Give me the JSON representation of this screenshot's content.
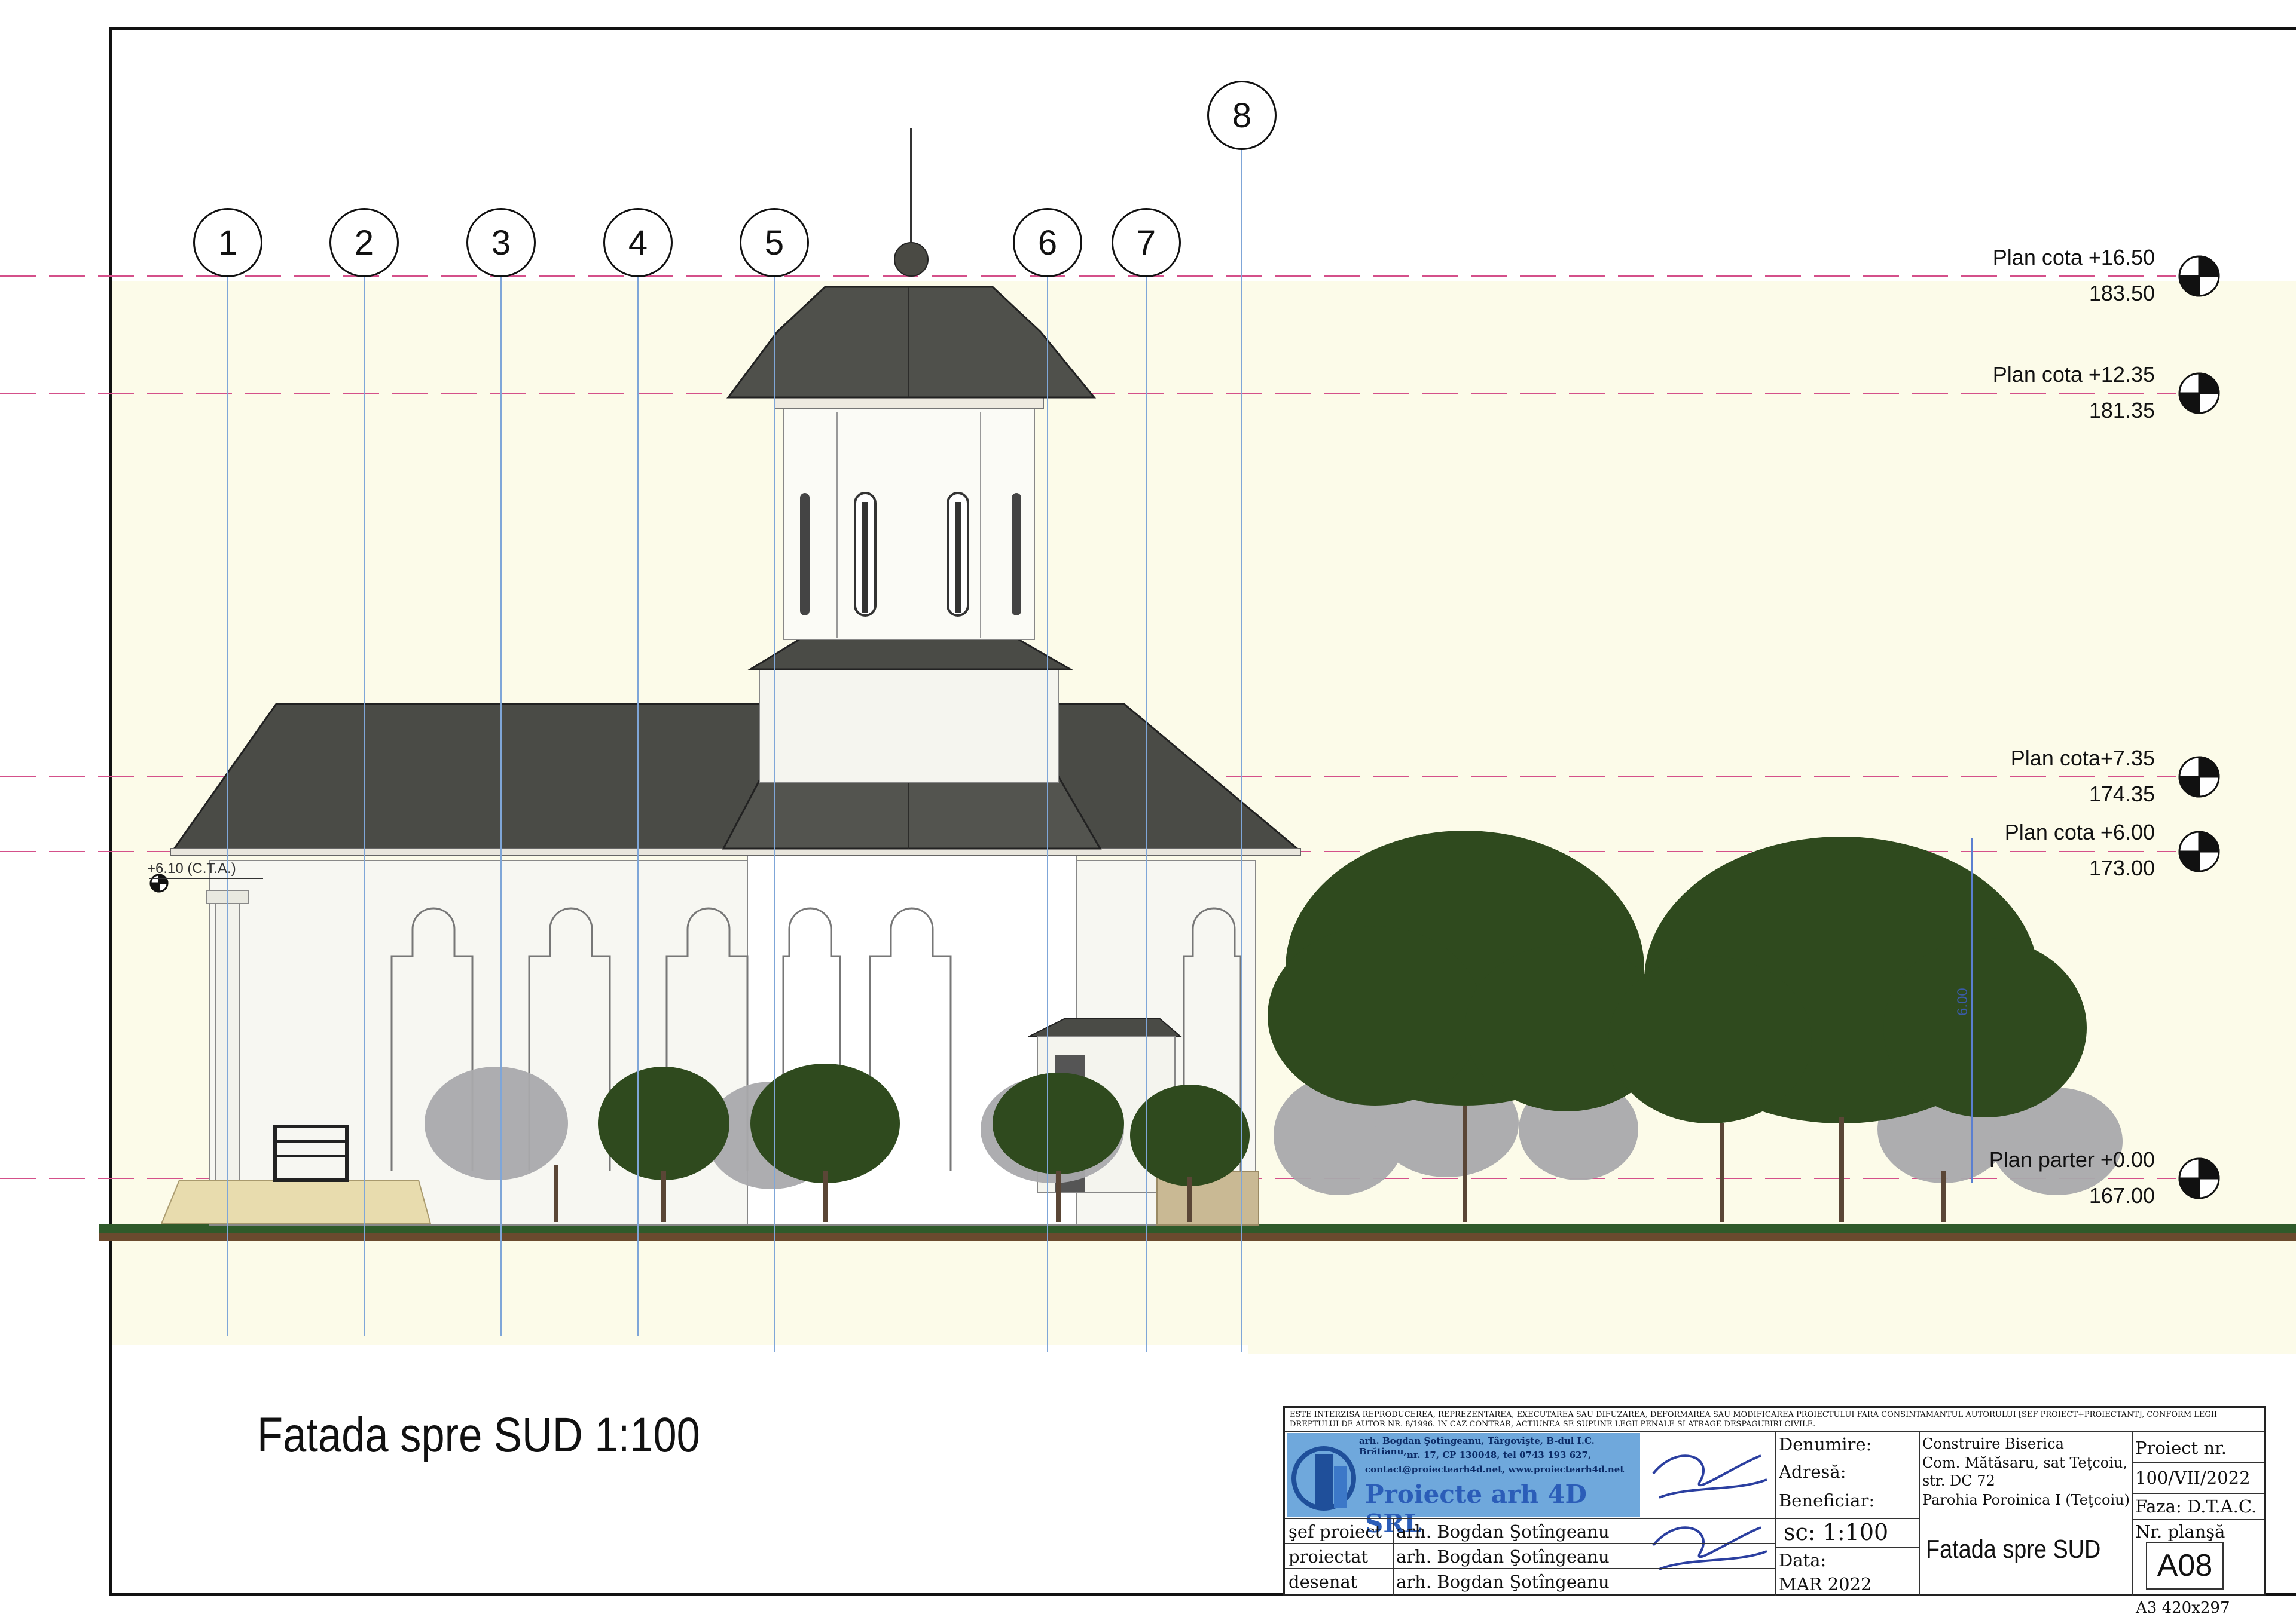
{
  "axes": [
    "1",
    "2",
    "3",
    "4",
    "5",
    "6",
    "7",
    "8"
  ],
  "levels": [
    {
      "label": "Plan cota +16.50",
      "value": "183.50"
    },
    {
      "label": "Plan cota +12.35",
      "value": "181.35"
    },
    {
      "label": "Plan cota+7.35",
      "value": "174.35"
    },
    {
      "label": "Plan cota +6.00",
      "value": "173.00"
    },
    {
      "label": "Plan parter +0.00",
      "value": "167.00"
    }
  ],
  "cta_label": "+6.10 (C.T.A.)",
  "dim_label": "6.00",
  "drawing_title": "Fatada spre SUD 1:100",
  "title_block": {
    "notice": "ESTE INTERZISA REPRODUCEREA, REPREZENTAREA, EXECUTAREA SAU DIFUZAREA, DEFORMAREA SAU MODIFICAREA PROIECTULUI FARA CONSINTAMANTUL AUTORULUI  [SEF PROIECT+PROIECTANT], CONFORM LEGII DREPTULUI DE AUTOR NR. 8/1996. IN CAZ CONTRAR, ACTIUNEA SE SUPUNE LEGII PENALE SI ATRAGE DESPAGUBIRI CIVILE.",
    "company_line1": "arh. Bogdan Şotîngeanu, Târgovişte, B-dul I.C. Brătianu,",
    "company_line2": "nr. 17, CP 130048, tel 0743 193 627,",
    "company_line3": "contact@proiectearh4d.net, www.proiectearh4d.net",
    "company_name": "Proiecte arh 4D SRL",
    "denumire_label": "Denumire:",
    "adresa_label": "Adresă:",
    "beneficiar_label": "Beneficiar:",
    "denumire_value": "Construire Biserica",
    "adresa_value_1": "Com. Mătăsaru, sat Teţcoiu,",
    "adresa_value_2": "str. DC 72",
    "beneficiar_value": "Parohia Poroinica I (Teţcoiu)",
    "proiect_nr_label": "Proiect nr.",
    "proiect_nr_value": "100/VII/2022",
    "faza": "Faza: D.T.A.C.",
    "sef_proiect_label": "şef proiect",
    "proiectat_label": "proiectat",
    "desenat_label": "desenat",
    "person": "arh. Bogdan Şotîngeanu",
    "scale": "sc: 1:100",
    "data_label": "Data:",
    "data_value": "MAR 2022",
    "sheet_title": "Fatada spre SUD",
    "nr_plansa_label": "Nr. planşă",
    "nr_plansa_value": "A08"
  },
  "paper_format": "A3 420x297",
  "colors": {
    "roof": "#4a4b46",
    "wall": "#f7f7f2",
    "tree_dark": "#2f4a1e",
    "tree_grey": "#a9a9ac",
    "level_line": "#d4508a",
    "axis_line": "#7fa6d8",
    "ground": "#2f5a2a",
    "soil": "#6a4a2e"
  }
}
